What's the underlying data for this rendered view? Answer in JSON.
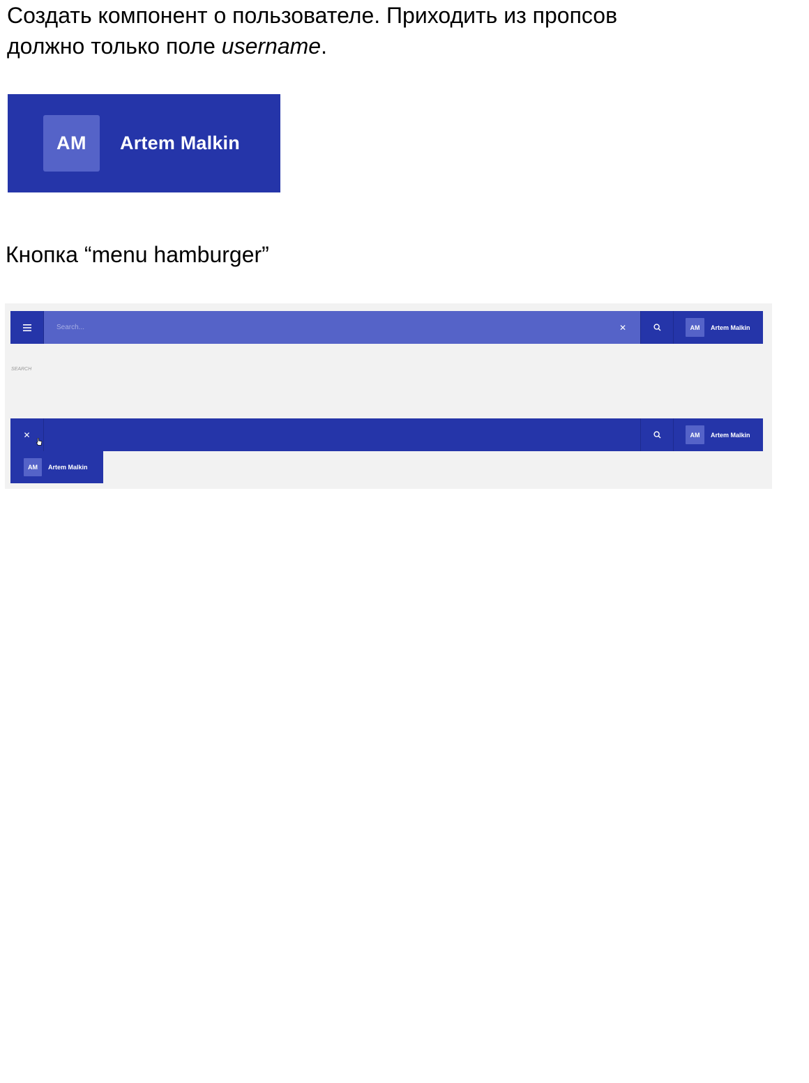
{
  "task": {
    "line1": "Создать компонент о пользователе. Приходить из пропсов",
    "line2_prefix": "должно только поле ",
    "line2_italic": "username",
    "line2_suffix": "."
  },
  "user_card": {
    "initials": "AM",
    "username": "Artem Malkin"
  },
  "section": {
    "title": "Кнопка “menu hamburger”"
  },
  "demo": {
    "search_placeholder": "Search...",
    "search_caption": "SEARCH",
    "initials": "AM",
    "username": "Artem Malkin",
    "icons": [
      "hamburger-icon",
      "close-icon",
      "search-icon",
      "pointer-cursor-icon"
    ],
    "colors": {
      "bar": "#2535a9",
      "search": "#5563c8",
      "avatar": "#5563c8",
      "panel": "#f2f2f2"
    }
  }
}
